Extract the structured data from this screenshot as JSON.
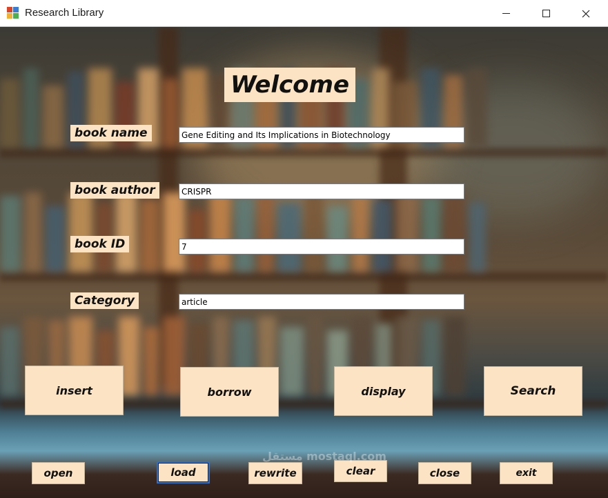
{
  "window": {
    "title": "Research Library",
    "icon": "app-window-icon"
  },
  "header": {
    "welcome": "Welcome"
  },
  "form": {
    "book_name_label": "book name",
    "book_name_value": "Gene Editing and Its Implications in Biotechnology",
    "book_author_label": "book author",
    "book_author_value": "CRISPR",
    "book_id_label": "book ID",
    "book_id_value": "7",
    "category_label": "Category",
    "category_value": "article"
  },
  "actions": {
    "insert": "insert",
    "borrow": "borrow",
    "display": "display",
    "search": "Search"
  },
  "file_actions": {
    "open": "open",
    "load": "load",
    "rewrite": "rewrite",
    "clear": "clear",
    "close": "close",
    "exit": "exit"
  },
  "watermark": "مستقل mostaql.com",
  "colors": {
    "label_bg": "#fbe3c3",
    "focus_border": "#2d6fd0"
  }
}
